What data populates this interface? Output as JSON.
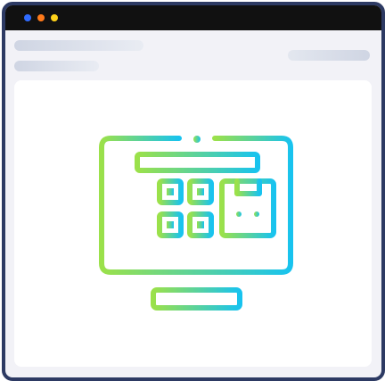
{
  "window": {
    "controls": [
      {
        "name": "close",
        "color": "#2f6bff"
      },
      {
        "name": "minimize",
        "color": "#ff7a1a"
      },
      {
        "name": "maximize",
        "color": "#ffd21a"
      }
    ],
    "frame_color": "#2d3a63",
    "titlebar_color": "#111111"
  },
  "header": {
    "placeholders": [
      "title-skeleton",
      "subtitle-skeleton",
      "action-skeleton"
    ]
  },
  "illustration": {
    "icon": "pos-monitor-icon",
    "gradient": [
      "#9be14a",
      "#18c3ef"
    ]
  }
}
